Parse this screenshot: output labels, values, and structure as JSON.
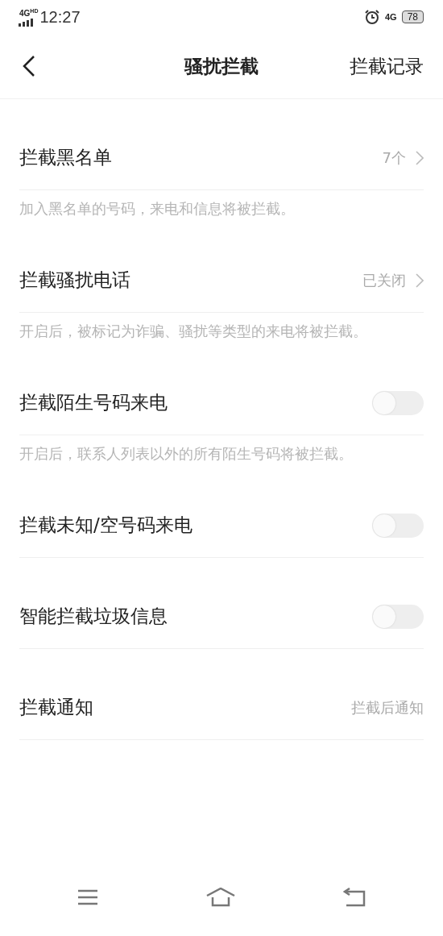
{
  "status_bar": {
    "network": "4G",
    "network_badge": "HD",
    "time": "12:27",
    "data_network": "4G",
    "battery": "78"
  },
  "header": {
    "title": "骚扰拦截",
    "action": "拦截记录"
  },
  "settings": [
    {
      "kind": "link",
      "label": "拦截黑名单",
      "value": "7个",
      "description": "加入黑名单的号码，来电和信息将被拦截。"
    },
    {
      "kind": "link",
      "label": "拦截骚扰电话",
      "value": "已关闭",
      "description": "开启后，被标记为诈骗、骚扰等类型的来电将被拦截。"
    },
    {
      "kind": "switch",
      "label": "拦截陌生号码来电",
      "on": false,
      "description": "开启后，联系人列表以外的所有陌生号码将被拦截。"
    },
    {
      "kind": "switch",
      "label": "拦截未知/空号码来电",
      "on": false
    },
    {
      "kind": "switch",
      "label": "智能拦截垃圾信息",
      "on": false
    },
    {
      "kind": "value",
      "label": "拦截通知",
      "value": "拦截后通知"
    }
  ]
}
